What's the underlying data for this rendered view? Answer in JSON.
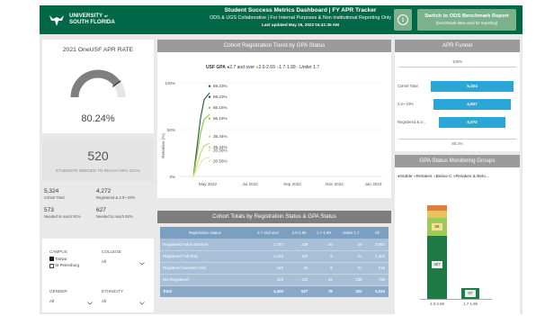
{
  "header": {
    "university_line1": "UNIVERSITY",
    "university_sup": "of",
    "university_line2": "SOUTH FLORIDA",
    "title": "Student Success Metrics Dashboard | FY APR Tracker",
    "subtitle": "ODS & UGS Collaborative | For Internal Purposes & Non Institutional Reporting Only",
    "updated": "Last updated May 26, 2022 04:41:35 AM",
    "info_glyph": "i",
    "switch_label": "Switch to ODS Benchmark Report",
    "switch_sub": "(benchmark data used for reporting)",
    "brand_color": "#006747"
  },
  "apr_rate": {
    "title": "2021 OneUSF APR RATE",
    "value": "80.24%",
    "gauge_fraction": 0.8024
  },
  "needed": {
    "value": "520",
    "label": "STUDENTS NEEDED TO REACH 90% GOAL"
  },
  "stats": [
    {
      "value": "5,324",
      "label": "Cohort Total"
    },
    {
      "value": "4,272",
      "label": "Registered & 2.0+ GPA"
    },
    {
      "value": "573",
      "label": "Needed to reach 91%"
    },
    {
      "value": "627",
      "label": "Needed to reach 92%"
    }
  ],
  "filters": {
    "campus_label": "CAMPUS",
    "campus_options": [
      "Tampa",
      "St Petersburg"
    ],
    "college_label": "COLLEGE",
    "college_value": "All",
    "gender_label": "GENDER",
    "gender_value": "All",
    "ethnicity_label": "ETHNICITY",
    "ethnicity_value": "All"
  },
  "trend": {
    "title": "Cohort Registration Trend by GPA Status",
    "legend_title": "USF GPA",
    "legend": [
      {
        "name": "2.7 and over",
        "color": "#1e5a3a"
      },
      {
        "name": "2.0-2.69",
        "color": "#8fc43c"
      },
      {
        "name": "1.7-1.99",
        "color": "#c2dc7a"
      },
      {
        "name": "Under 1.7",
        "color": "#e2ebb0"
      }
    ],
    "y_axis_label": "Retention (%)",
    "y_ticks": [
      "100%",
      "50%",
      "0%"
    ],
    "x_ticks": [
      "May 2022",
      "Jul 2022",
      "Sep 2022",
      "Nov 2022",
      "Jan 2023"
    ]
  },
  "chart_data": {
    "type": "line",
    "ylabel": "Retention (%)",
    "ylim": [
      0,
      100
    ],
    "x_ticks": [
      "May 2022",
      "Jul 2022",
      "Sep 2022",
      "Nov 2022",
      "Jan 2023"
    ],
    "series": [
      {
        "name": "2.7 and over",
        "end_labels": [
          "89.23%",
          "89.23%"
        ],
        "color": "#1e5a3a"
      },
      {
        "name": "2.0-2.69",
        "end_labels": [
          "66.16%",
          "66.16%"
        ],
        "color": "#8fc43c"
      },
      {
        "name": "1.7-1.99",
        "end_labels": [
          "35.44%",
          "35.44%"
        ],
        "color": "#c2dc7a"
      },
      {
        "name": "Under 1.7",
        "end_labels": [
          "20.56%",
          "20.56%"
        ],
        "color": "#e2ebb0"
      }
    ]
  },
  "table": {
    "title": "Cohort Totals by Registration Status & GPA Status",
    "headers": [
      "Registration Status",
      "2.7 and over",
      "2.0-2.69",
      "1.7-1.99",
      "Under 1.7",
      "All"
    ],
    "rows": [
      [
        "Registered Fall & Summer",
        "2,757",
        "239",
        "20",
        "45",
        "3,061"
      ],
      [
        "Registered Fall Only",
        "1,163",
        "100",
        "8",
        "21",
        "1,304"
      ],
      [
        "Registered Summer Only",
        "145",
        "44",
        "8",
        "21",
        "218"
      ],
      [
        "Not Registered",
        "328",
        "133",
        "42",
        "235",
        "738"
      ]
    ],
    "total": [
      "Total",
      "4,400",
      "527",
      "78",
      "322",
      "5,324"
    ]
  },
  "funnel": {
    "title": "APR Funnel",
    "top_pct": "100%",
    "bottom_pct": "80.2%",
    "rows": [
      {
        "label": "Cohort Total",
        "value": "5,324",
        "fraction": 1.0
      },
      {
        "label": "2.0+ GPA",
        "value": "4,927",
        "fraction": 0.925
      },
      {
        "label": "Registered & 2...",
        "value": "4,272",
        "fraction": 0.802
      }
    ],
    "color": "#2aa7d6"
  },
  "groups": {
    "title": "GPA Status Monitoring Groups",
    "legend": [
      {
        "name": "Stable",
        "color": "#1e7a44"
      },
      {
        "name": "Retakes",
        "color": "#9dc85a"
      },
      {
        "name": "Below C",
        "color": "#e6c35c"
      },
      {
        "name": "Retakes & Belo...",
        "color": "#e07d3c"
      }
    ],
    "bars": [
      {
        "category": "2.0-2.69",
        "stable": "407",
        "retakes": "59"
      },
      {
        "category": "1.7-1.99",
        "stable": "67"
      }
    ]
  }
}
